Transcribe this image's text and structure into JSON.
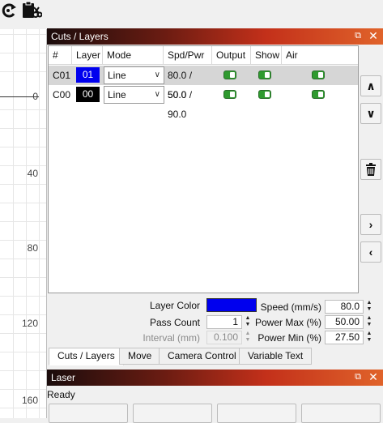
{
  "panels": {
    "cuts_layers": {
      "title": "Cuts / Layers"
    },
    "laser": {
      "title": "Laser",
      "status": "Ready"
    }
  },
  "ruler": {
    "labels": [
      "0",
      "40",
      "80",
      "120",
      "160"
    ]
  },
  "table": {
    "headers": [
      "#",
      "Layer",
      "Mode",
      "Spd/Pwr",
      "Output",
      "Show",
      "Air"
    ],
    "rows": [
      {
        "id": "C01",
        "layer": "01",
        "layer_color": "#0000ee",
        "mode": "Line",
        "spd_pwr": "80.0 / 50.0",
        "output": true,
        "show": true,
        "air": true,
        "selected": true
      },
      {
        "id": "C00",
        "layer": "00",
        "layer_color": "#000000",
        "mode": "Line",
        "spd_pwr": "50.0 / 90.0",
        "output": true,
        "show": true,
        "air": true,
        "selected": false
      }
    ]
  },
  "settings": {
    "layer_color_label": "Layer Color",
    "layer_color": "#0000ee",
    "pass_count_label": "Pass Count",
    "pass_count": "1",
    "interval_label": "Interval (mm)",
    "interval": "0.100",
    "speed_label": "Speed (mm/s)",
    "speed": "80.0",
    "power_max_label": "Power Max (%)",
    "power_max": "50.00",
    "power_min_label": "Power Min (%)",
    "power_min": "27.50"
  },
  "tabs": [
    "Cuts / Layers",
    "Move",
    "Camera Control",
    "Variable Text"
  ],
  "icons": {
    "toolbar": [
      "rotate-icon",
      "clipboard-cut-icon"
    ],
    "side": [
      "chevron-up-icon",
      "chevron-down-icon",
      "trash-icon",
      "chevron-right-icon",
      "chevron-left-icon"
    ]
  }
}
